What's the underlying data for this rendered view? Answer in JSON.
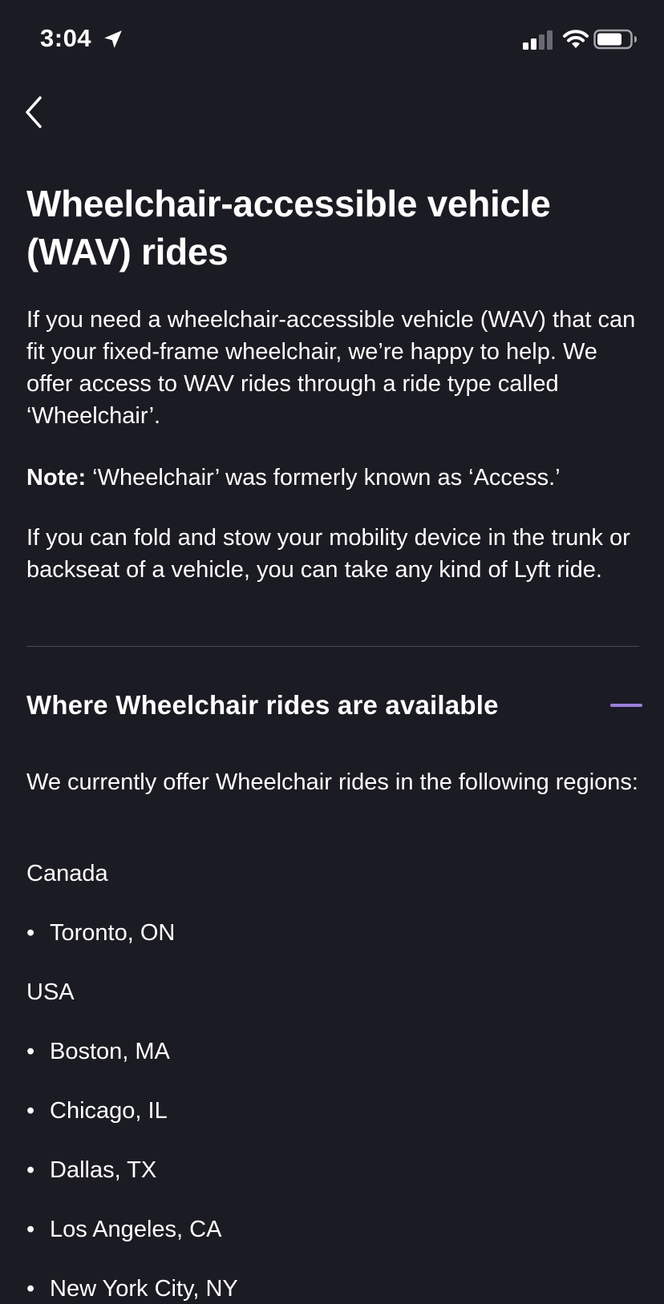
{
  "status_bar": {
    "time": "3:04",
    "icons": [
      "location-arrow-icon",
      "cellular-signal-icon",
      "wifi-icon",
      "battery-icon"
    ]
  },
  "nav": {
    "back_icon": "chevron-left-icon"
  },
  "article": {
    "title": "Wheelchair-accessible vehicle (WAV) rides",
    "intro_paragraph": "If you need a wheelchair-accessible vehicle (WAV) that can fit your fixed-frame wheelchair, we’re happy to help. We offer access to WAV rides through a ride type called ‘Wheelchair’.",
    "note_label": "Note:",
    "note_text": " ‘Wheelchair’ was formerly known as ‘Access.’",
    "fold_paragraph": "If you can fold and stow your mobility device in the trunk or backseat of a vehicle, you can take any kind of Lyft ride."
  },
  "section": {
    "title": "Where Wheelchair rides are available",
    "toggle_icon": "minus-collapse-icon",
    "accent_color": "#9b7fe0",
    "intro": "We currently offer Wheelchair rides in the following regions:",
    "groups": [
      {
        "label": "Canada",
        "regions": [
          "Toronto, ON"
        ]
      },
      {
        "label": "USA",
        "regions": [
          "Boston, MA",
          "Chicago, IL",
          "Dallas, TX",
          "Los Angeles, CA",
          "New York City, NY"
        ]
      }
    ],
    "bullet": "•"
  },
  "colors": {
    "background": "#1b1b23",
    "text": "#ffffff",
    "divider": "#4b4b55"
  }
}
